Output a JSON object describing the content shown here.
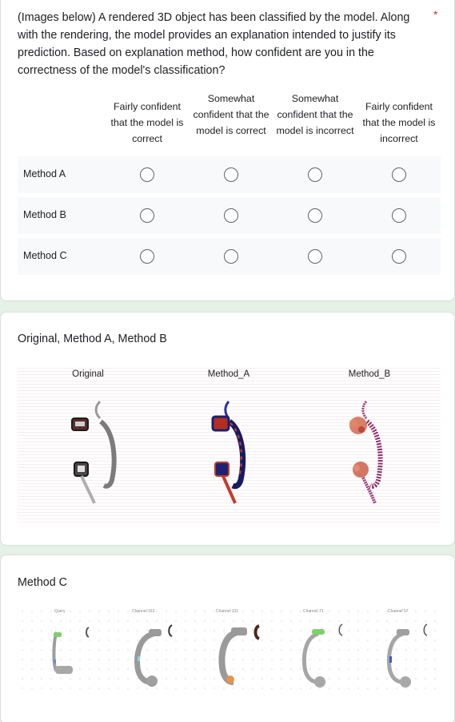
{
  "question": {
    "text": "(Images below) A rendered 3D object has been classified by the model. Along with the rendering, the model provides an explanation intended to justify its prediction. Based on explanation method, how confident are you in the correctness of the model's classification?",
    "required_mark": "*"
  },
  "grid": {
    "columns": [
      "Fairly confident that the model is correct",
      "Somewhat confident that the model is correct",
      "Somewhat confident that the model is incorrect",
      "Fairly confident that the model is incorrect"
    ],
    "rows": [
      "Method A",
      "Method B",
      "Method C"
    ]
  },
  "section2": {
    "title": "Original, Method A, Method B",
    "panels": [
      "Original",
      "Method_A",
      "Method_B"
    ]
  },
  "section3": {
    "title": "Method C",
    "thumbs": [
      "Query",
      "Channel 163",
      "Channel 211",
      "Channel 71",
      "Channel 57"
    ]
  },
  "colors": {
    "background": "#e5f0e6",
    "card": "#ffffff",
    "row_bg": "#f8f9fa",
    "radio_border": "#5f6368",
    "required": "#d93025"
  }
}
